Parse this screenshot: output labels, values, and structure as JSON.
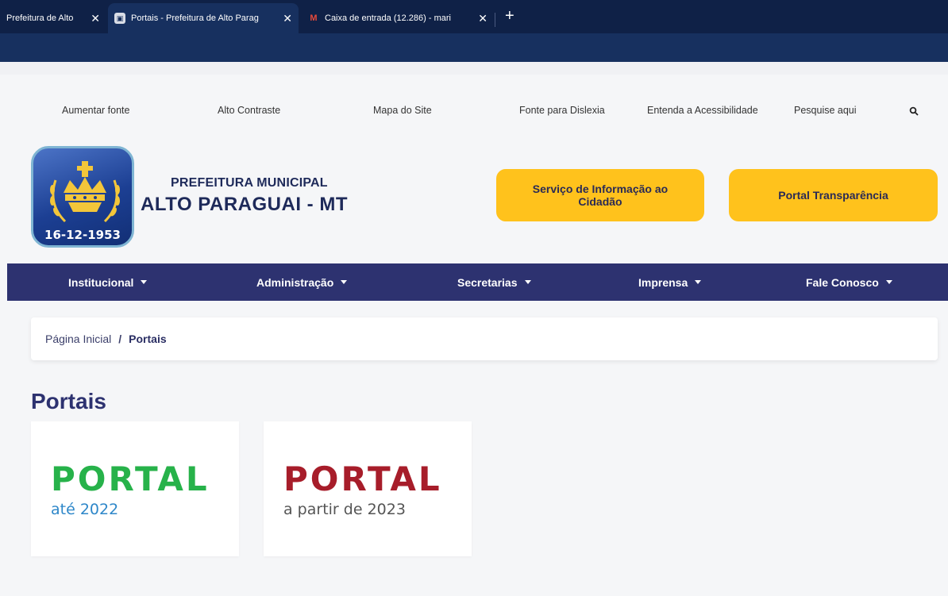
{
  "browser": {
    "tabs": [
      {
        "label": "Prefeitura de Alto",
        "favicon": "prefeitura-favicon",
        "active": false
      },
      {
        "label": "Portais - Prefeitura de Alto Parag",
        "favicon": "prefeitura-favicon",
        "active": true
      },
      {
        "label": "Caixa de entrada (12.286) - mari",
        "favicon": "gmail-icon",
        "active": false
      }
    ],
    "close_glyph": "✕",
    "new_tab_glyph": "+",
    "colors": {
      "tabstrip": "#0f2147",
      "toolbar": "#17305f"
    }
  },
  "accessibility_bar": {
    "items": [
      "Aumentar fonte",
      "Alto Contraste",
      "Mapa do Site",
      "Fonte para Dislexia",
      "Entenda a Acessibilidade"
    ],
    "search_placeholder": "Pesquise aqui",
    "search_icon": "search-icon"
  },
  "header": {
    "logo_date": "16-12-1953",
    "logo_line1": "PREFEITURA MUNICIPAL",
    "logo_line2": "ALTO PARAGUAI - MT",
    "buttons": [
      {
        "label": "Serviço de Informação ao Cidadão"
      },
      {
        "label": "Portal Transparência"
      }
    ],
    "colors": {
      "yellow": "#ffc21c",
      "brand": "#2d3270"
    }
  },
  "nav": {
    "items": [
      "Institucional",
      "Administração",
      "Secretarias",
      "Imprensa",
      "Fale Conosco"
    ]
  },
  "breadcrumb": {
    "home": "Página Inicial",
    "separator": "/",
    "current": "Portais"
  },
  "main": {
    "title": "Portais",
    "cards": [
      {
        "title": "PORTAL",
        "subtitle": "até 2022",
        "title_color": "#27b24a",
        "subtitle_color": "#2e87c9"
      },
      {
        "title": "PORTAL",
        "subtitle": "a partir de 2023",
        "title_color": "#a71d2a",
        "subtitle_color": "#555555"
      }
    ]
  }
}
